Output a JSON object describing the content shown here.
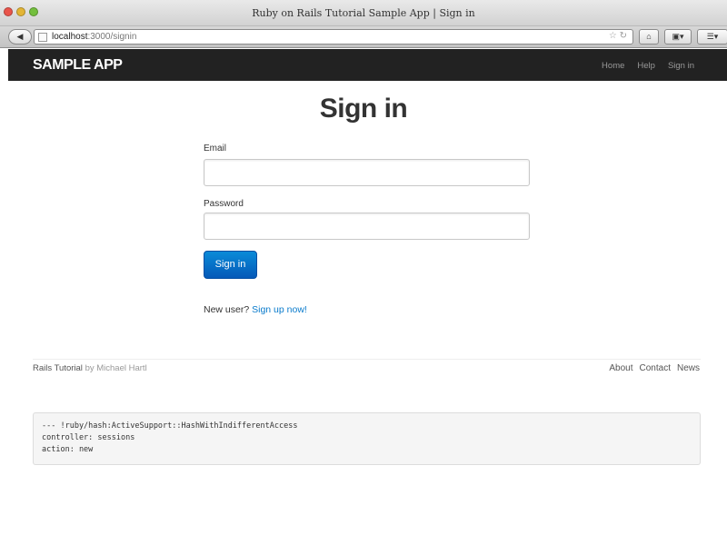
{
  "browser": {
    "window_title": "Ruby on Rails Tutorial Sample App | Sign in",
    "url_host": "localhost",
    "url_rest": ":3000/signin"
  },
  "navbar": {
    "brand": "SAMPLE APP",
    "links": [
      "Home",
      "Help",
      "Sign in"
    ]
  },
  "form": {
    "heading": "Sign in",
    "email_label": "Email",
    "email_value": "",
    "password_label": "Password",
    "password_value": "",
    "submit_label": "Sign in",
    "new_user_text": "New user?",
    "signup_link": "Sign up now!"
  },
  "footer": {
    "site_name": "Rails Tutorial",
    "by_text": "by",
    "author": "Michael Hartl",
    "links": [
      "About",
      "Contact",
      "News"
    ]
  },
  "debug": {
    "lines": [
      "--- !ruby/hash:ActiveSupport::HashWithIndifferentAccess",
      "controller: sessions",
      "action: new"
    ]
  },
  "colors": {
    "navbar_bg": "#222222",
    "link": "#0a7bcc",
    "button": "#0769c9"
  }
}
